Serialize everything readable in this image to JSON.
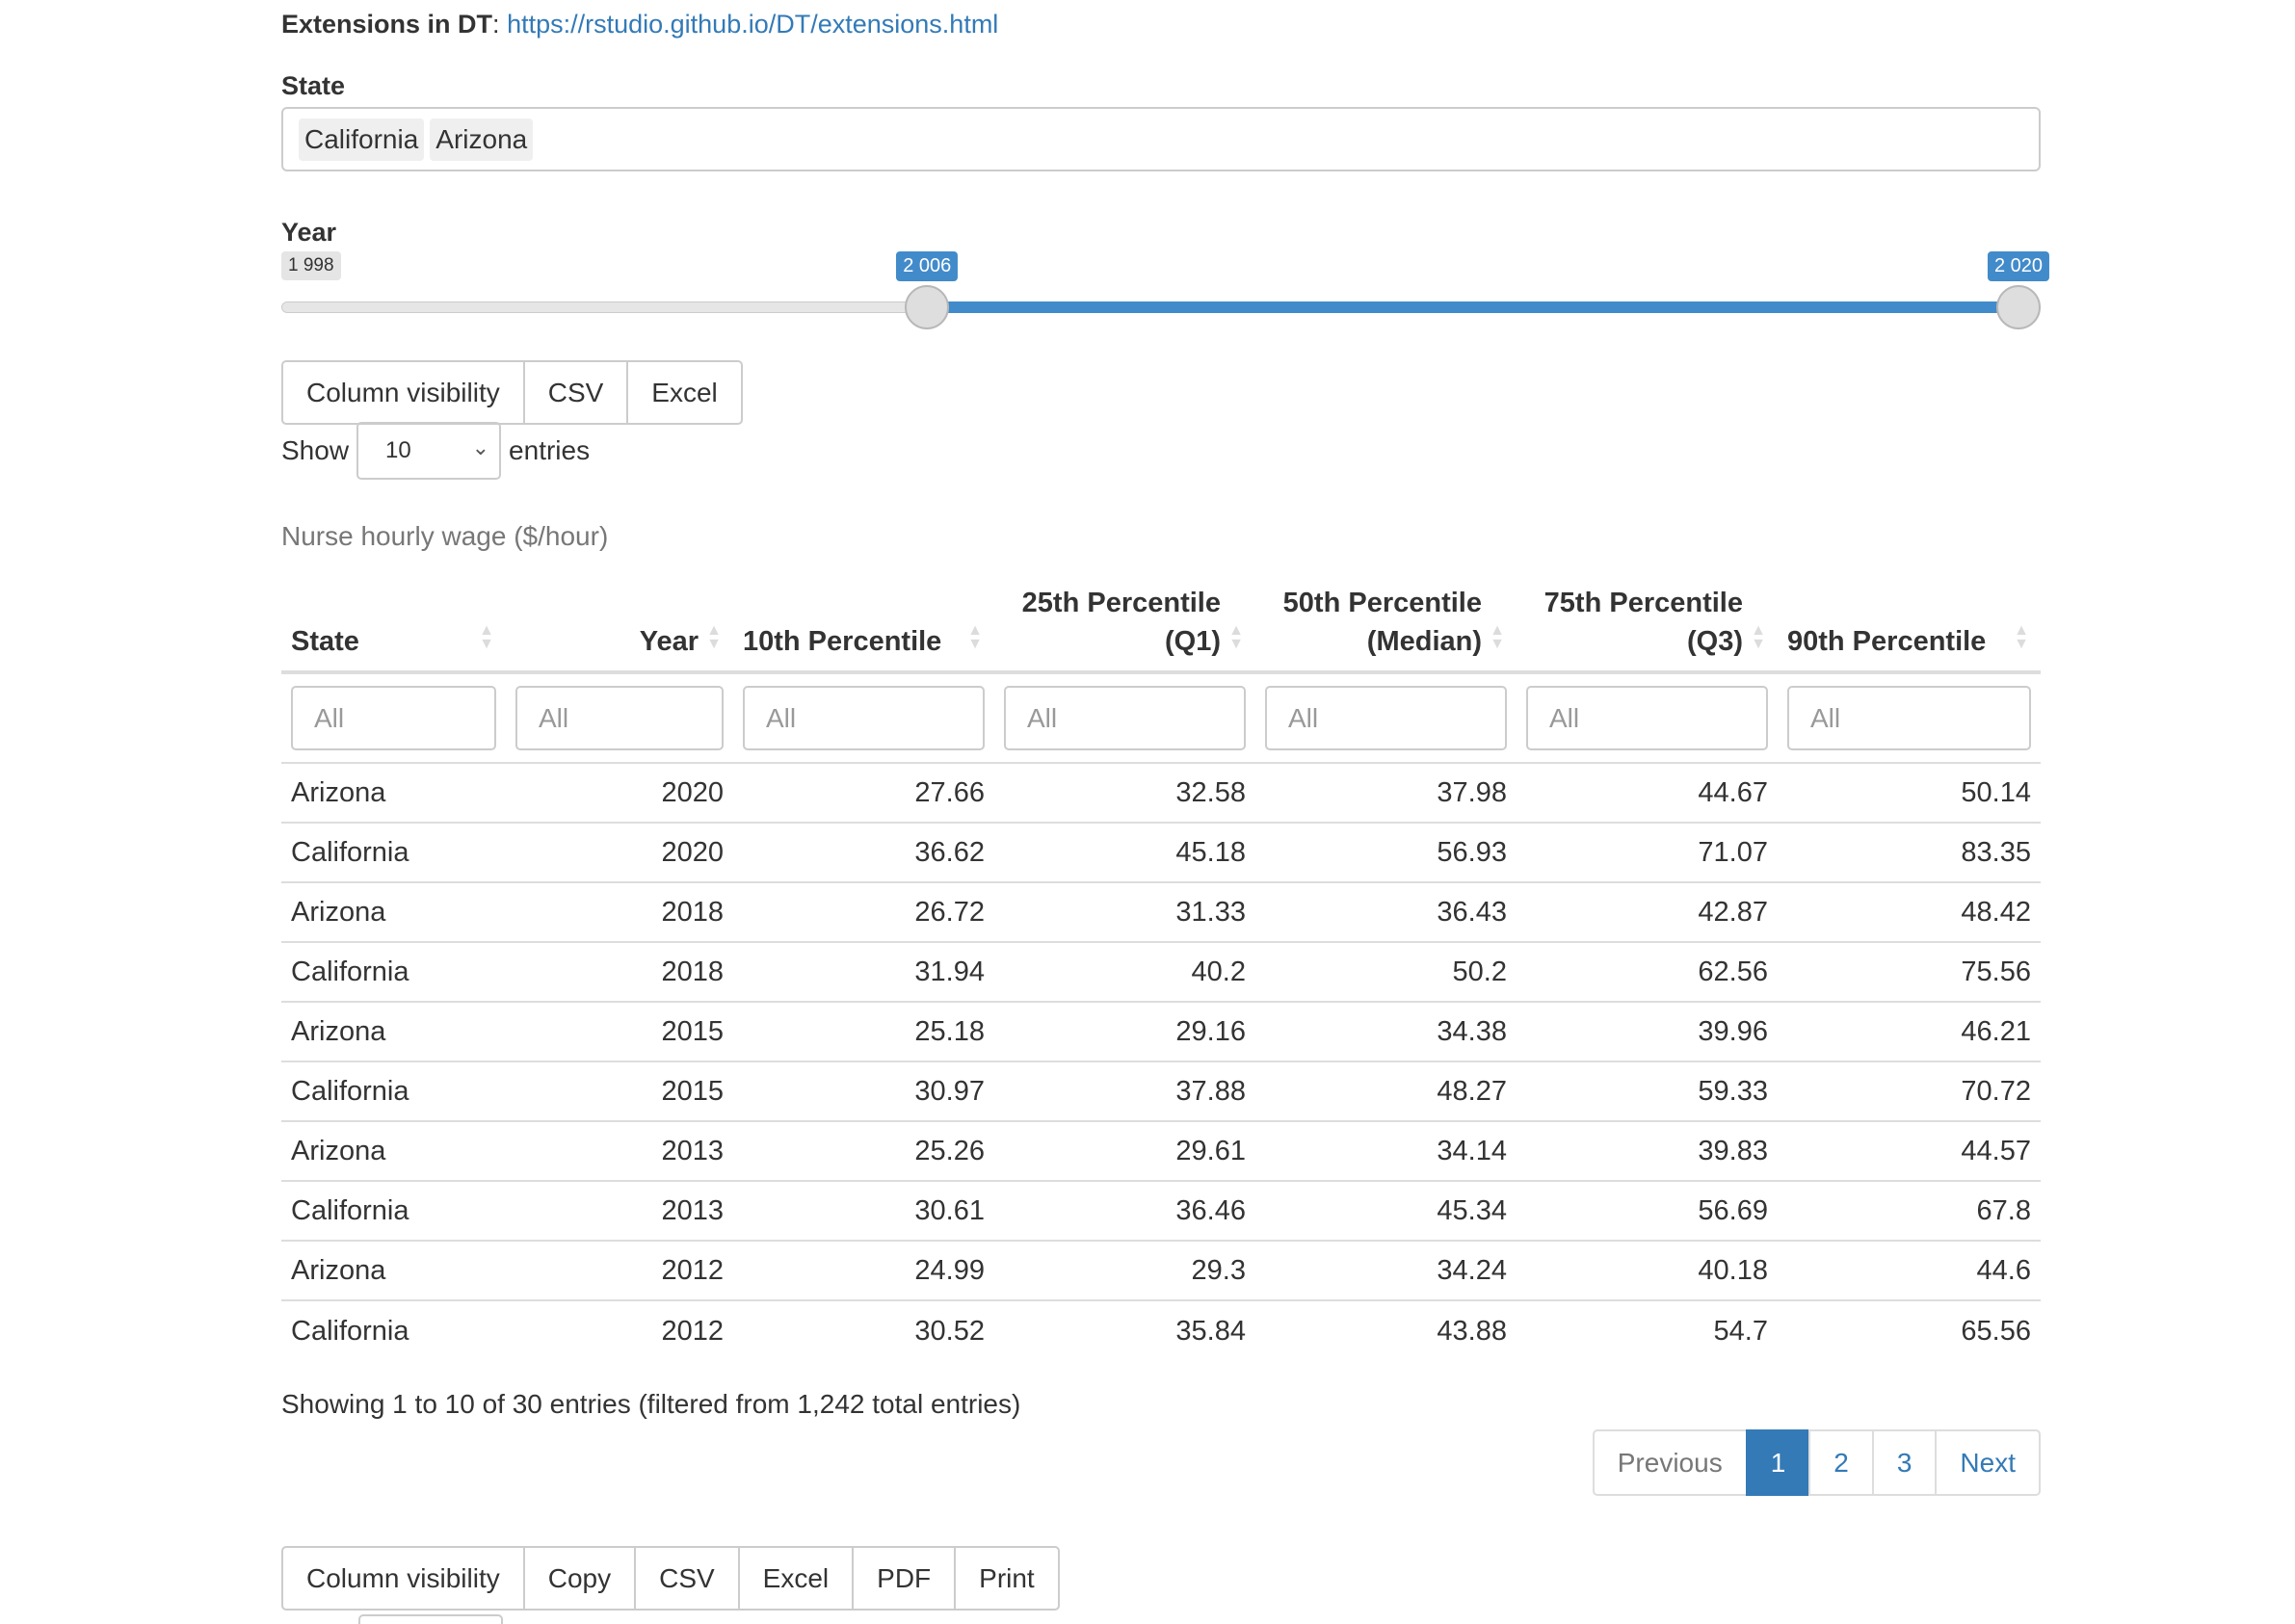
{
  "extensions": {
    "label": "Extensions in DT",
    "sep": ": ",
    "url": "https://rstudio.github.io/DT/extensions.html"
  },
  "state_filter": {
    "label": "State",
    "selected": [
      "California",
      "Arizona"
    ]
  },
  "year_slider": {
    "label": "Year",
    "min_label": "1 998",
    "low_label": "2 006",
    "high_label": "2 020",
    "min": 1998,
    "max": 2020,
    "low": 2006,
    "high": 2020
  },
  "buttons_top": [
    "Column visibility",
    "CSV",
    "Excel"
  ],
  "length_menu": {
    "before": "Show",
    "value": "10",
    "after": "entries"
  },
  "table": {
    "caption": "Nurse hourly wage ($/hour)",
    "headers": [
      [
        "State"
      ],
      [
        "Year"
      ],
      [
        "10th Percentile"
      ],
      [
        "25th Percentile",
        "(Q1)"
      ],
      [
        "50th Percentile",
        "(Median)"
      ],
      [
        "75th Percentile",
        "(Q3)"
      ],
      [
        "90th Percentile"
      ]
    ],
    "filter_placeholder": "All",
    "rows": [
      [
        "Arizona",
        "2020",
        "27.66",
        "32.58",
        "37.98",
        "44.67",
        "50.14"
      ],
      [
        "California",
        "2020",
        "36.62",
        "45.18",
        "56.93",
        "71.07",
        "83.35"
      ],
      [
        "Arizona",
        "2018",
        "26.72",
        "31.33",
        "36.43",
        "42.87",
        "48.42"
      ],
      [
        "California",
        "2018",
        "31.94",
        "40.2",
        "50.2",
        "62.56",
        "75.56"
      ],
      [
        "Arizona",
        "2015",
        "25.18",
        "29.16",
        "34.38",
        "39.96",
        "46.21"
      ],
      [
        "California",
        "2015",
        "30.97",
        "37.88",
        "48.27",
        "59.33",
        "70.72"
      ],
      [
        "Arizona",
        "2013",
        "25.26",
        "29.61",
        "34.14",
        "39.83",
        "44.57"
      ],
      [
        "California",
        "2013",
        "30.61",
        "36.46",
        "45.34",
        "56.69",
        "67.8"
      ],
      [
        "Arizona",
        "2012",
        "24.99",
        "29.3",
        "34.24",
        "40.18",
        "44.6"
      ],
      [
        "California",
        "2012",
        "30.52",
        "35.84",
        "43.88",
        "54.7",
        "65.56"
      ]
    ]
  },
  "info": "Showing 1 to 10 of 30 entries (filtered from 1,242 total entries)",
  "pagination": {
    "previous": "Previous",
    "pages": [
      "1",
      "2",
      "3"
    ],
    "active": "1",
    "next": "Next"
  },
  "buttons_bottom": [
    "Column visibility",
    "Copy",
    "CSV",
    "Excel",
    "PDF",
    "Print"
  ],
  "colors": {
    "accent": "#428bca",
    "link": "#337ab7",
    "border": "#dddddd"
  }
}
